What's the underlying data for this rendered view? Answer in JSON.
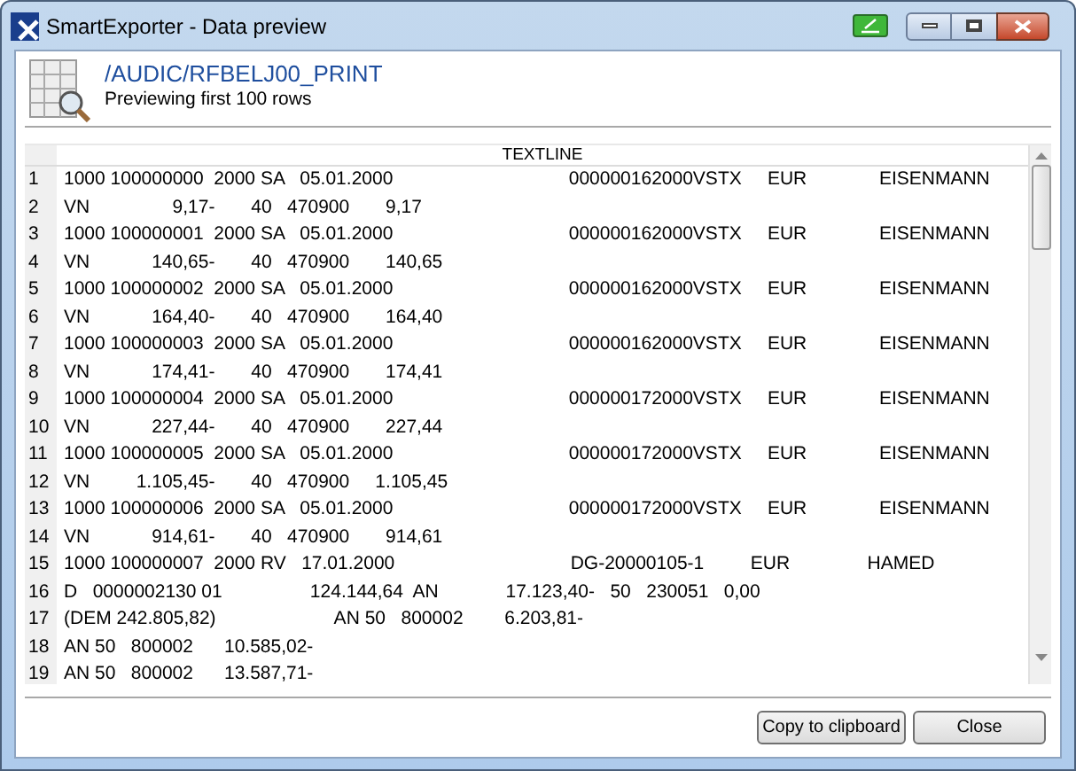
{
  "window": {
    "title": "SmartExporter - Data preview"
  },
  "header": {
    "title": "/AUDIC/RFBELJ00_PRINT",
    "subtitle": "Previewing first 100 rows"
  },
  "table": {
    "columns": [
      "TEXTLINE"
    ],
    "rows": [
      {
        "number": "1",
        "text": "1000 100000000  2000 SA   05.01.2000                                  000000162000VSTX     EUR              EISENMANN"
      },
      {
        "number": "2",
        "text": "VN                9,17-       40   470900       9,17"
      },
      {
        "number": "3",
        "text": "1000 100000001  2000 SA   05.01.2000                                  000000162000VSTX     EUR              EISENMANN"
      },
      {
        "number": "4",
        "text": "VN            140,65-       40   470900       140,65"
      },
      {
        "number": "5",
        "text": "1000 100000002  2000 SA   05.01.2000                                  000000162000VSTX     EUR              EISENMANN"
      },
      {
        "number": "6",
        "text": "VN            164,40-       40   470900       164,40"
      },
      {
        "number": "7",
        "text": "1000 100000003  2000 SA   05.01.2000                                  000000162000VSTX     EUR              EISENMANN"
      },
      {
        "number": "8",
        "text": "VN            174,41-       40   470900       174,41"
      },
      {
        "number": "9",
        "text": "1000 100000004  2000 SA   05.01.2000                                  000000172000VSTX     EUR              EISENMANN"
      },
      {
        "number": "10",
        "text": "VN            227,44-       40   470900       227,44"
      },
      {
        "number": "11",
        "text": "1000 100000005  2000 SA   05.01.2000                                  000000172000VSTX     EUR              EISENMANN"
      },
      {
        "number": "12",
        "text": "VN         1.105,45-       40   470900     1.105,45"
      },
      {
        "number": "13",
        "text": "1000 100000006  2000 SA   05.01.2000                                  000000172000VSTX     EUR              EISENMANN"
      },
      {
        "number": "14",
        "text": "VN            914,61-       40   470900       914,61"
      },
      {
        "number": "15",
        "text": "1000 100000007  2000 RV   17.01.2000                                  DG-20000105-1         EUR               HAMED"
      },
      {
        "number": "16",
        "text": "D   0000002130 01                 124.144,64  AN             17.123,40-   50   230051   0,00"
      },
      {
        "number": "17",
        "text": "(DEM 242.805,82)                       AN 50   800002        6.203,81-"
      },
      {
        "number": "18",
        "text": "AN 50   800002      10.585,02-"
      },
      {
        "number": "19",
        "text": "AN 50   800002      13.587,71-"
      }
    ]
  },
  "buttons": [
    "Copy to clipboard",
    "Close"
  ]
}
